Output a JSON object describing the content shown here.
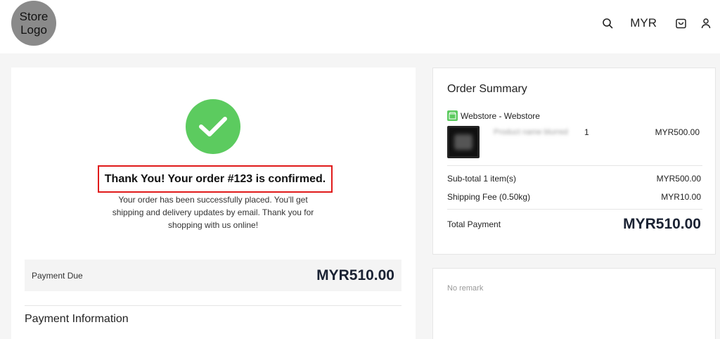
{
  "header": {
    "logo_line1": "Store",
    "logo_line2": "Logo",
    "currency": "MYR",
    "icons": [
      "search-icon",
      "shopping-bag-icon",
      "user-icon"
    ]
  },
  "confirmation": {
    "title": "Thank You! Your order #123 is confirmed.",
    "description": "Your order has been successfully placed. You'll get shipping and delivery updates by email. Thank you for shopping with us online!",
    "check_color": "#5ccb5f",
    "highlight_color": "#e01b1b"
  },
  "payment": {
    "due_label": "Payment Due",
    "due_amount": "MYR510.00",
    "info_heading": "Payment Information"
  },
  "summary": {
    "title": "Order Summary",
    "store_name": "Webstore - Webstore",
    "item": {
      "name": "Product name blurred",
      "quantity": "1",
      "price": "MYR500.00"
    },
    "subtotal_label": "Sub-total 1 item(s)",
    "subtotal_value": "MYR500.00",
    "shipping_label": "Shipping Fee (0.50kg)",
    "shipping_value": "MYR10.00",
    "total_label": "Total Payment",
    "total_value": "MYR510.00"
  },
  "remark": {
    "text": "No remark"
  }
}
